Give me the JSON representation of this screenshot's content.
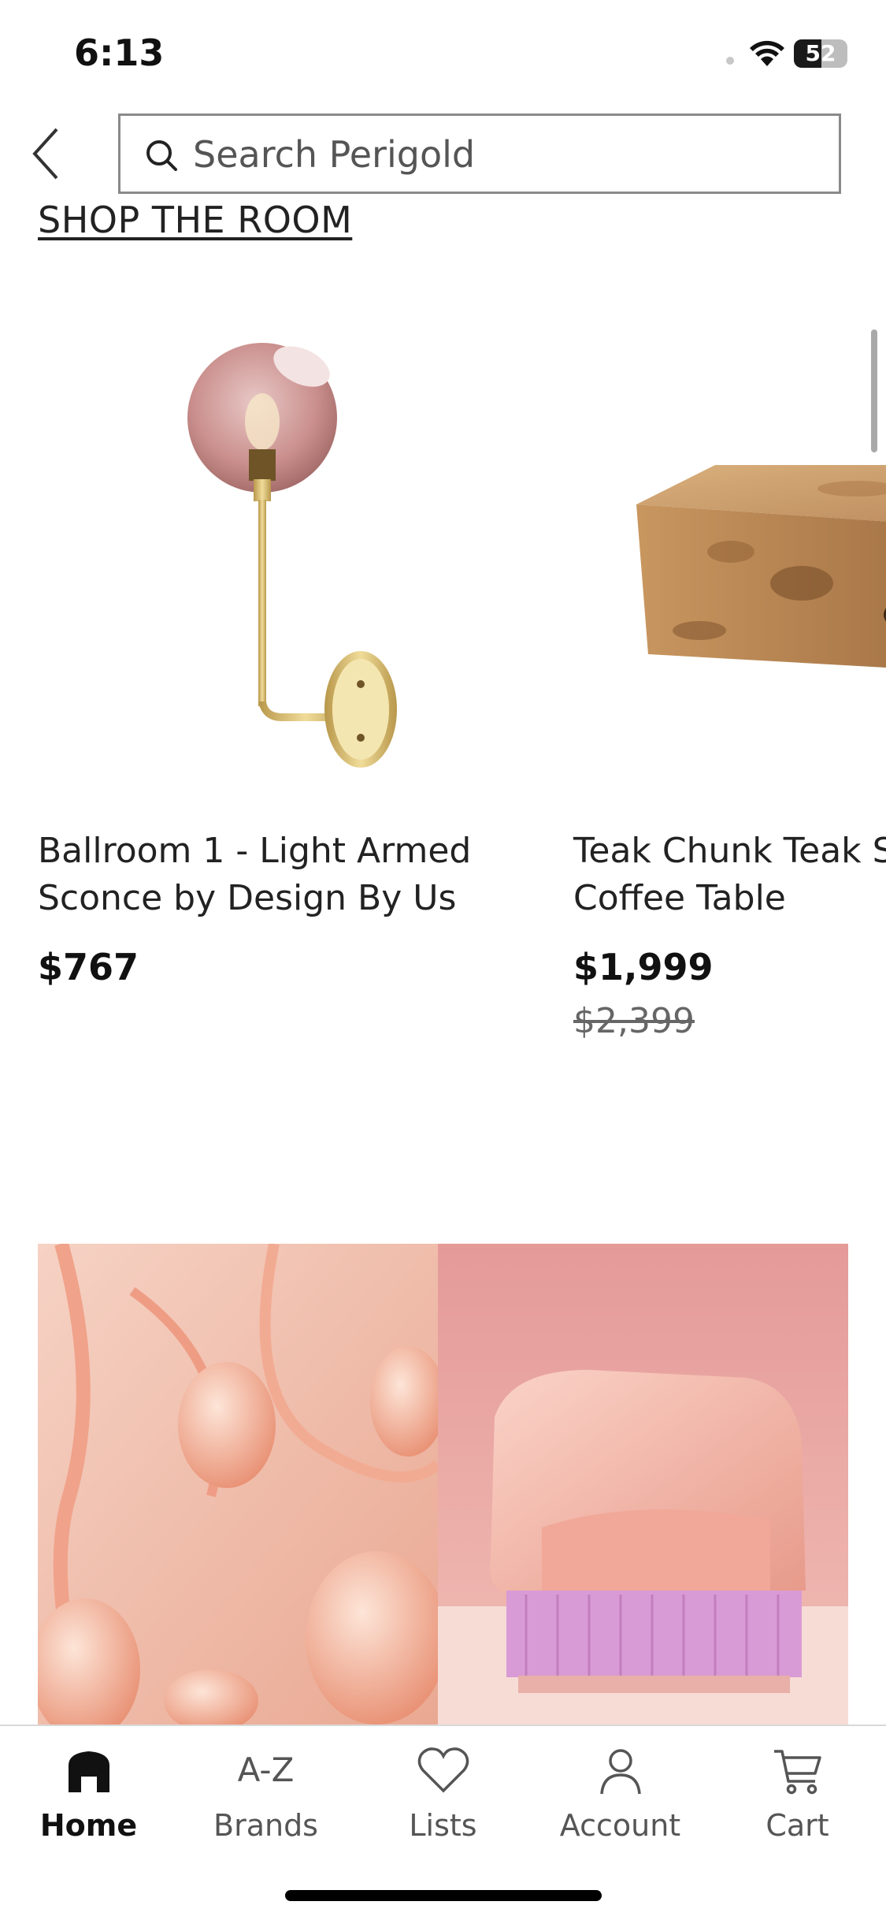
{
  "status_bar": {
    "time": "6:13",
    "battery_level": "52",
    "battery_fraction": 0.52
  },
  "header": {
    "back_icon": "chevron-left-icon",
    "search_placeholder": "Search Perigold",
    "search_icon": "search-icon"
  },
  "shop_the_room": {
    "label": "SHOP THE ROOM"
  },
  "products": [
    {
      "title": "Ballroom 1 - Light Armed\nSconce by Design By Us",
      "price": "$767",
      "original_price": ""
    },
    {
      "title": "Teak Chunk Teak Solid Wood\nCoffee Table",
      "price": "$1,999",
      "original_price": "$2,399"
    }
  ],
  "tabs": [
    {
      "label": "Home",
      "icon": "home-icon",
      "active": true
    },
    {
      "label": "Brands",
      "icon": "A-Z",
      "active": false
    },
    {
      "label": "Lists",
      "icon": "heart-icon",
      "active": false
    },
    {
      "label": "Account",
      "icon": "person-icon",
      "active": false
    },
    {
      "label": "Cart",
      "icon": "cart-icon",
      "active": false
    }
  ],
  "colors": {
    "text": "#1f1f1f",
    "muted": "#555555",
    "border": "#8a8a8a",
    "accent_pink": "#e9a08f"
  }
}
